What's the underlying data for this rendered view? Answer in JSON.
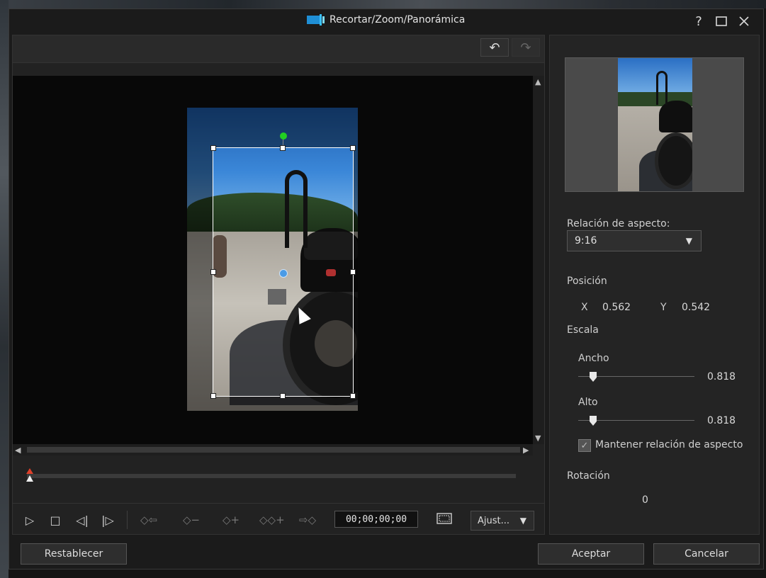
{
  "window": {
    "title": "Recortar/Zoom/Panorámica",
    "help_label": "?",
    "maximize_label": "☐",
    "close_label": "✕"
  },
  "toolbar": {
    "undo_label": "↶",
    "redo_label": "↷"
  },
  "transport": {
    "play_label": "▷",
    "stop_label": "□",
    "prev_frame_label": "◁|",
    "next_frame_label": "|▷",
    "kf_prev_label": "◇⇦",
    "kf_remove_label": "◇−",
    "kf_add_label": "◇+",
    "kf_dup_label": "◇◇+",
    "kf_next_label": "⇨◇",
    "timecode": "00;00;00;00",
    "fit_label": "Ajust...",
    "fit_arrow": "▼"
  },
  "timeline": {
    "position": 0
  },
  "panel": {
    "aspect_label": "Relación de aspecto:",
    "aspect_value": "9:16",
    "aspect_arrow": "▼",
    "position_label": "Posición",
    "x_label": "X",
    "x_value": "0.562",
    "y_label": "Y",
    "y_value": "0.542",
    "scale_label": "Escala",
    "width_label": "Ancho",
    "width_value": "0.818",
    "height_label": "Alto",
    "height_value": "0.818",
    "keep_ratio_label": "Mantener relación de aspecto",
    "keep_ratio_checked": true,
    "rotation_label": "Rotación",
    "rotation_value": "0"
  },
  "footer": {
    "reset_label": "Restablecer",
    "accept_label": "Aceptar",
    "cancel_label": "Cancelar"
  },
  "colors": {
    "accent_rotation_handle": "#22d022",
    "center_handle": "#4a9be6"
  }
}
